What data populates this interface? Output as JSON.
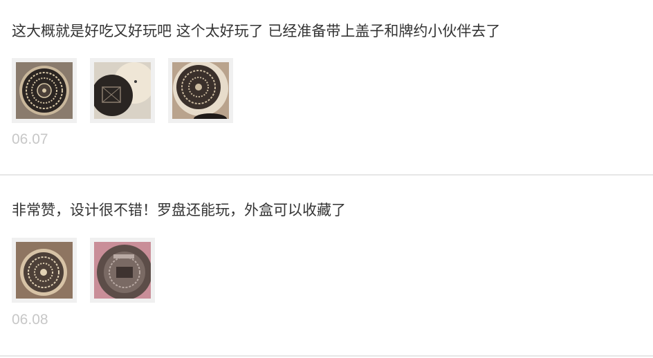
{
  "reviews": [
    {
      "text": "这大概就是好吃又好玩吧 这个太好玩了 已经准备带上盖子和牌约小伙伴去了",
      "date": "06.07",
      "photos": [
        "review-photo-compass-lid",
        "review-photo-box-open",
        "review-photo-compass-closeup"
      ]
    },
    {
      "text": "非常赞，设计很不错！罗盘还能玩，外盒可以收藏了",
      "date": "06.08",
      "photos": [
        "review-photo-compass-wide",
        "review-photo-compass-pink"
      ]
    }
  ],
  "colors": {
    "text": "#333333",
    "date": "#c7c7c7",
    "divider": "#e6e6e6",
    "thumb_frame": "#f0f0f0"
  }
}
